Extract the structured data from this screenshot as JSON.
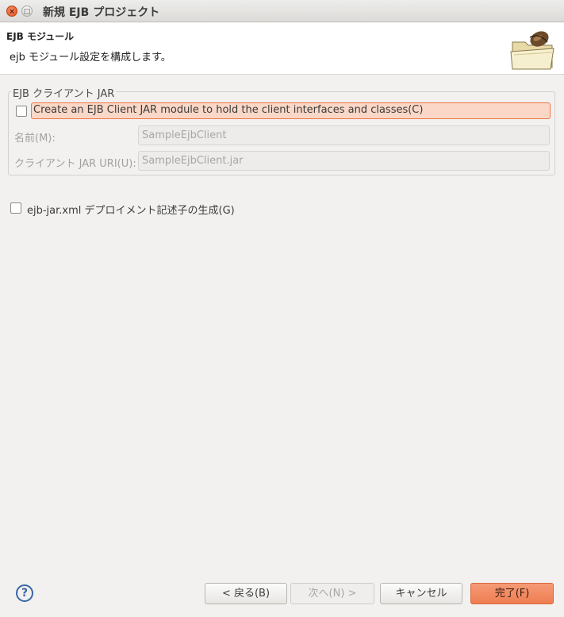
{
  "window": {
    "title": "新規 EJB プロジェクト",
    "close_glyph": "×",
    "maximize_glyph": "□"
  },
  "header": {
    "title": "EJB モジュール",
    "description": "ejb モジュール設定を構成します。",
    "icon": "folder-with-bean-icon"
  },
  "client_jar_group": {
    "title": "EJB クライアント JAR",
    "create_checkbox": {
      "label": "Create an EJB Client JAR module to hold the client interfaces and classes(C)",
      "checked": false
    },
    "name_field": {
      "label": "名前(M):",
      "value": "SampleEjbClient",
      "enabled": false
    },
    "uri_field": {
      "label": "クライアント JAR URI(U):",
      "value": "SampleEjbClient.jar",
      "enabled": false
    }
  },
  "deployment_descriptor_checkbox": {
    "label": "ejb-jar.xml デプロイメント記述子の生成(G)",
    "checked": false
  },
  "footer": {
    "help_glyph": "?",
    "back_label": "< 戻る(B)",
    "next_label": "次へ(N) >",
    "cancel_label": "キャンセル",
    "finish_label": "完了(F)"
  },
  "colors": {
    "accent": "#ef7d51",
    "highlight_bg": "#fad7c6",
    "help_blue": "#3a66a6"
  }
}
